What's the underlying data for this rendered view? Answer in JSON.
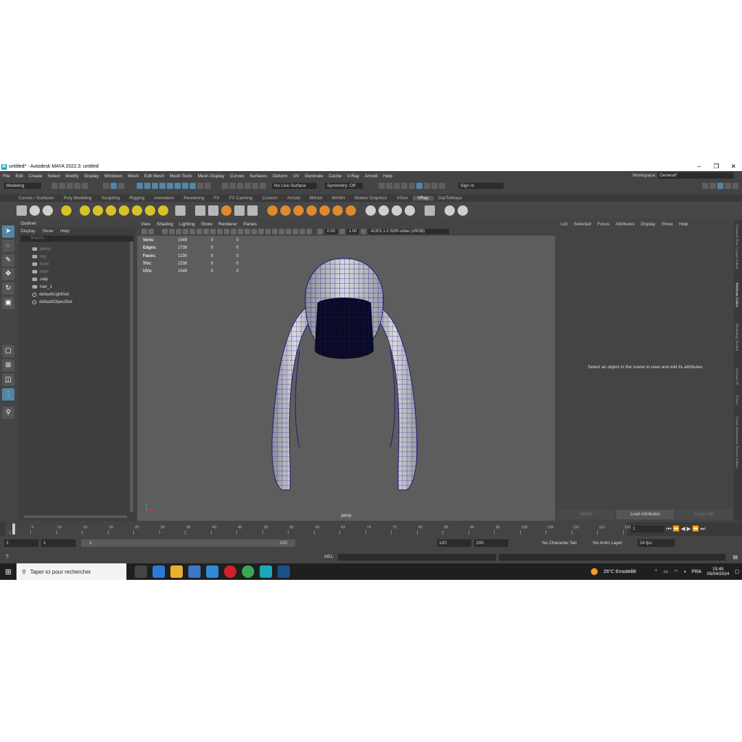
{
  "window": {
    "title": "untitled* - Autodesk MAYA 2022.3: untitled",
    "logo": "M"
  },
  "menu": [
    "File",
    "Edit",
    "Create",
    "Select",
    "Modify",
    "Display",
    "Windows",
    "Mesh",
    "Edit Mesh",
    "Mesh Tools",
    "Mesh Display",
    "Curves",
    "Surfaces",
    "Deform",
    "UV",
    "Generate",
    "Cache",
    "V-Ray",
    "Arnold",
    "Help"
  ],
  "workspace": {
    "label": "Workspace:",
    "value": "General*"
  },
  "status": {
    "mode": "Modeling",
    "live_surface": "No Live Surface",
    "symmetry": "Symmetry: Off",
    "sign_in": "Sign In"
  },
  "shelf_tabs": [
    "Curves / Surfaces",
    "Poly Modeling",
    "Sculpting",
    "Rigging",
    "Animation",
    "Rendering",
    "FX",
    "FX Caching",
    "Custom",
    "Arnold",
    "Bifrost",
    "MASH",
    "Motion Graphics",
    "XGen",
    "VRay",
    "DazToMaya"
  ],
  "shelf_active": "VRay",
  "outliner": {
    "title": "Outliner",
    "menu": [
      "Display",
      "Show",
      "Help"
    ],
    "search_placeholder": "Search...",
    "items": [
      {
        "label": "persp",
        "dim": true,
        "kind": "camera"
      },
      {
        "label": "top",
        "dim": true,
        "kind": "camera"
      },
      {
        "label": "front",
        "dim": true,
        "kind": "camera"
      },
      {
        "label": "side",
        "dim": true,
        "kind": "camera"
      },
      {
        "label": "salp",
        "dim": false,
        "kind": "mesh"
      },
      {
        "label": "hair_1",
        "dim": false,
        "kind": "mesh"
      },
      {
        "label": "defaultLightSet",
        "dim": false,
        "kind": "set"
      },
      {
        "label": "defaultObjectSet",
        "dim": false,
        "kind": "set"
      }
    ]
  },
  "viewport": {
    "menu": [
      "View",
      "Shading",
      "Lighting",
      "Show",
      "Renderer",
      "Panels"
    ],
    "exposure": "0.00",
    "gamma": "1.00",
    "color_space": "ACES 1.0 SDR-video (sRGB)",
    "camera": "persp",
    "hud": [
      {
        "label": "Verts:",
        "v1": "1549",
        "v2": "0",
        "v3": "0"
      },
      {
        "label": "Edges:",
        "v1": "2739",
        "v2": "0",
        "v3": "0"
      },
      {
        "label": "Faces:",
        "v1": "1230",
        "v2": "0",
        "v3": "0"
      },
      {
        "label": "Tris:",
        "v1": "2238",
        "v2": "0",
        "v3": "0"
      },
      {
        "label": "UVs:",
        "v1": "1549",
        "v2": "0",
        "v3": "0"
      }
    ]
  },
  "attribute_editor": {
    "menu": [
      "List",
      "Selected",
      "Focus",
      "Attributes",
      "Display",
      "Show",
      "Help"
    ],
    "message": "Select an object in the scene to view and edit its attributes",
    "buttons": {
      "select": "Select",
      "load": "Load Attributes",
      "copy": "Copy Tab"
    }
  },
  "side_tabs": [
    "Channel Box / Layer Editor",
    "Attribute Editor",
    "Modeling Toolkit",
    "Human IK",
    "XGen",
    "XGen Interactive Groom Editor"
  ],
  "timeline": {
    "ticks": [
      "5",
      "10",
      "15",
      "20",
      "25",
      "30",
      "35",
      "40",
      "45",
      "50",
      "55",
      "60",
      "65",
      "70",
      "75",
      "80",
      "85",
      "90",
      "95",
      "100",
      "105",
      "110",
      "115",
      "120"
    ],
    "current_frame": "1"
  },
  "range": {
    "start": "1",
    "playback_start": "1",
    "range_start": "1",
    "range_end": "120",
    "playback_end": "120",
    "end": "200",
    "character_set": "No Character Set",
    "anim_layer": "No Anim Layer",
    "fps": "24 fps"
  },
  "command": {
    "mel": "MEL"
  },
  "taskbar": {
    "search": "Taper ici pour rechercher",
    "weather": "26°C  Ensoleillé",
    "lang": "FRA",
    "time": "15:45",
    "date": "05/04/2024"
  }
}
